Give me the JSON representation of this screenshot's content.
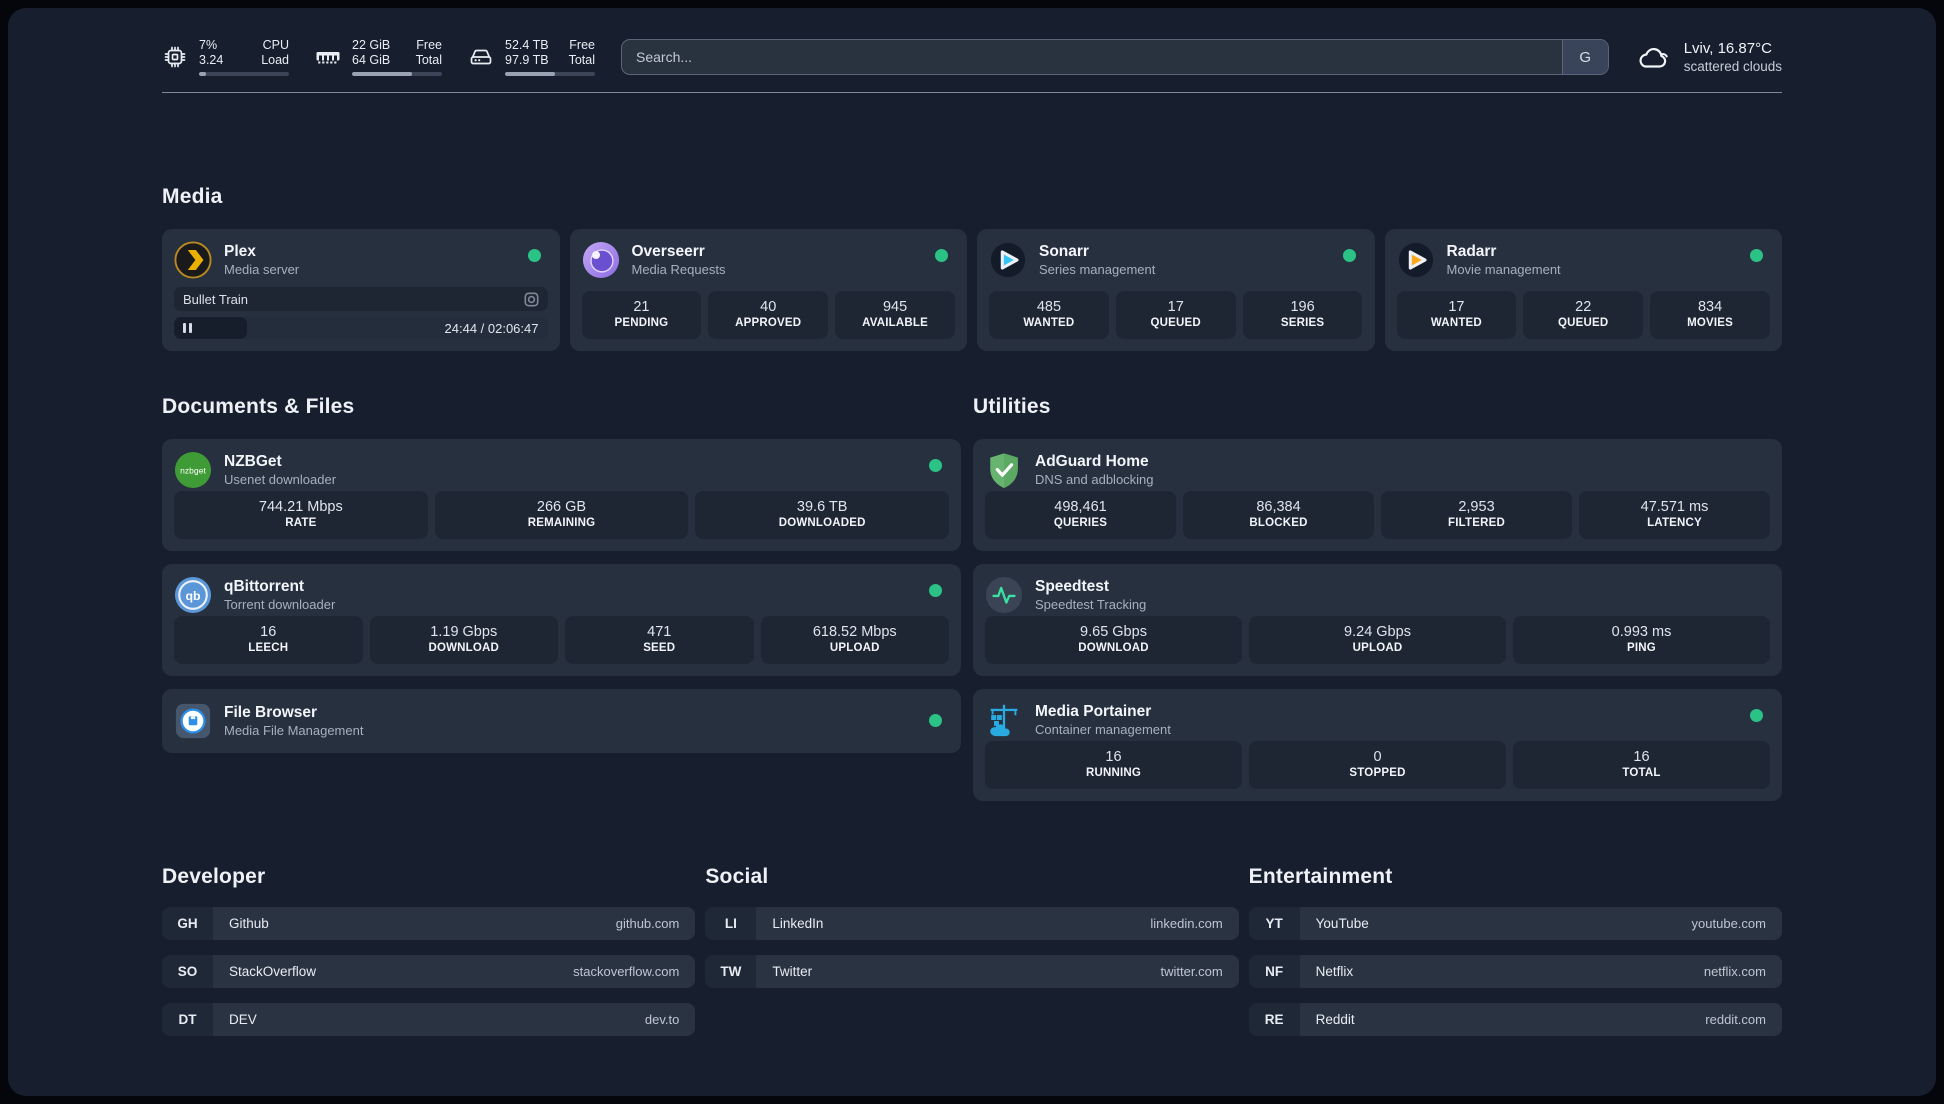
{
  "topbar": {
    "cpu": {
      "value1": "7%",
      "value2": "3.24",
      "label1": "CPU",
      "label2": "Load",
      "progress_pct": 8
    },
    "memory": {
      "value1": "22 GiB",
      "value2": "64 GiB",
      "label1": "Free",
      "label2": "Total",
      "progress_pct": 67
    },
    "disk": {
      "value1": "52.4 TB",
      "value2": "97.9 TB",
      "label1": "Free",
      "label2": "Total",
      "progress_pct": 55
    },
    "search": {
      "placeholder": "Search...",
      "provider_button": "G"
    },
    "weather": {
      "location": "Lviv, 16.87°C",
      "condition": "scattered clouds"
    }
  },
  "colors": {
    "status_online": "#2BC286",
    "accent_green": "#2BC286"
  },
  "sections": {
    "media": {
      "title": "Media",
      "plex": {
        "name": "Plex",
        "description": "Media server",
        "status": "online",
        "now_playing": {
          "title": "Bullet Train",
          "time_display": "24:44 / 02:06:47",
          "progress_pct": 19.5
        }
      },
      "overseerr": {
        "name": "Overseerr",
        "description": "Media Requests",
        "status": "online",
        "stats": [
          {
            "value": "21",
            "label": "PENDING"
          },
          {
            "value": "40",
            "label": "APPROVED"
          },
          {
            "value": "945",
            "label": "AVAILABLE"
          }
        ]
      },
      "sonarr": {
        "name": "Sonarr",
        "description": "Series management",
        "status": "online",
        "stats": [
          {
            "value": "485",
            "label": "WANTED"
          },
          {
            "value": "17",
            "label": "QUEUED"
          },
          {
            "value": "196",
            "label": "SERIES"
          }
        ]
      },
      "radarr": {
        "name": "Radarr",
        "description": "Movie management",
        "status": "online",
        "stats": [
          {
            "value": "17",
            "label": "WANTED"
          },
          {
            "value": "22",
            "label": "QUEUED"
          },
          {
            "value": "834",
            "label": "MOVIES"
          }
        ]
      }
    },
    "documents": {
      "title": "Documents & Files",
      "nzbget": {
        "name": "NZBGet",
        "description": "Usenet downloader",
        "status": "online",
        "stats": [
          {
            "value": "744.21 Mbps",
            "label": "RATE"
          },
          {
            "value": "266 GB",
            "label": "REMAINING"
          },
          {
            "value": "39.6 TB",
            "label": "DOWNLOADED"
          }
        ]
      },
      "qbittorrent": {
        "name": "qBittorrent",
        "description": "Torrent downloader",
        "status": "online",
        "stats": [
          {
            "value": "16",
            "label": "LEECH"
          },
          {
            "value": "1.19 Gbps",
            "label": "DOWNLOAD"
          },
          {
            "value": "471",
            "label": "SEED"
          },
          {
            "value": "618.52 Mbps",
            "label": "UPLOAD"
          }
        ]
      },
      "filebrowser": {
        "name": "File Browser",
        "description": "Media File Management",
        "status": "online"
      }
    },
    "utilities": {
      "title": "Utilities",
      "adguard": {
        "name": "AdGuard Home",
        "description": "DNS and adblocking",
        "stats": [
          {
            "value": "498,461",
            "label": "QUERIES"
          },
          {
            "value": "86,384",
            "label": "BLOCKED"
          },
          {
            "value": "2,953",
            "label": "FILTERED"
          },
          {
            "value": "47.571 ms",
            "label": "LATENCY"
          }
        ]
      },
      "speedtest": {
        "name": "Speedtest",
        "description": "Speedtest Tracking",
        "stats": [
          {
            "value": "9.65 Gbps",
            "label": "DOWNLOAD"
          },
          {
            "value": "9.24 Gbps",
            "label": "UPLOAD"
          },
          {
            "value": "0.993 ms",
            "label": "PING"
          }
        ]
      },
      "portainer": {
        "name": "Media Portainer",
        "description": "Container management",
        "status": "online",
        "stats": [
          {
            "value": "16",
            "label": "RUNNING"
          },
          {
            "value": "0",
            "label": "STOPPED"
          },
          {
            "value": "16",
            "label": "TOTAL"
          }
        ]
      }
    },
    "links": {
      "developer": {
        "title": "Developer",
        "items": [
          {
            "abbr": "GH",
            "name": "Github",
            "url": "github.com"
          },
          {
            "abbr": "SO",
            "name": "StackOverflow",
            "url": "stackoverflow.com"
          },
          {
            "abbr": "DT",
            "name": "DEV",
            "url": "dev.to"
          }
        ]
      },
      "social": {
        "title": "Social",
        "items": [
          {
            "abbr": "LI",
            "name": "LinkedIn",
            "url": "linkedin.com"
          },
          {
            "abbr": "TW",
            "name": "Twitter",
            "url": "twitter.com"
          }
        ]
      },
      "entertainment": {
        "title": "Entertainment",
        "items": [
          {
            "abbr": "YT",
            "name": "YouTube",
            "url": "youtube.com"
          },
          {
            "abbr": "NF",
            "name": "Netflix",
            "url": "netflix.com"
          },
          {
            "abbr": "RE",
            "name": "Reddit",
            "url": "reddit.com"
          }
        ]
      }
    }
  }
}
